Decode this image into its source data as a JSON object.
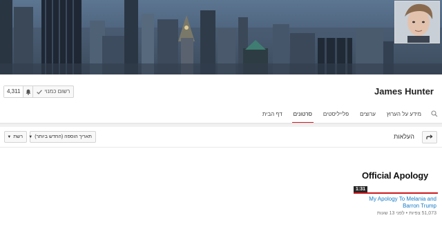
{
  "channel": {
    "name": "James Hunter"
  },
  "subscribe": {
    "label": "רשום כמנוי",
    "count": "4,311"
  },
  "tabs": [
    {
      "label": "דף הבית"
    },
    {
      "label": "סרטונים",
      "active": true
    },
    {
      "label": "פלייליסטים"
    },
    {
      "label": "ערוצים"
    },
    {
      "label": "מידע על הערוץ"
    }
  ],
  "filters": {
    "uploads_label": "העלאות",
    "sort_label": "תאריך הוספה (החדש ביותר)",
    "view_label": "רשת"
  },
  "videos": [
    {
      "thumbnail_text": "Official Apology",
      "duration": "1:31",
      "title": "My Apology To Melania and Barron Trump",
      "meta": "51,073 צפיות • לפני 13 שעות"
    }
  ],
  "colors": {
    "accent": "#cc181e",
    "link": "#167ac6"
  }
}
